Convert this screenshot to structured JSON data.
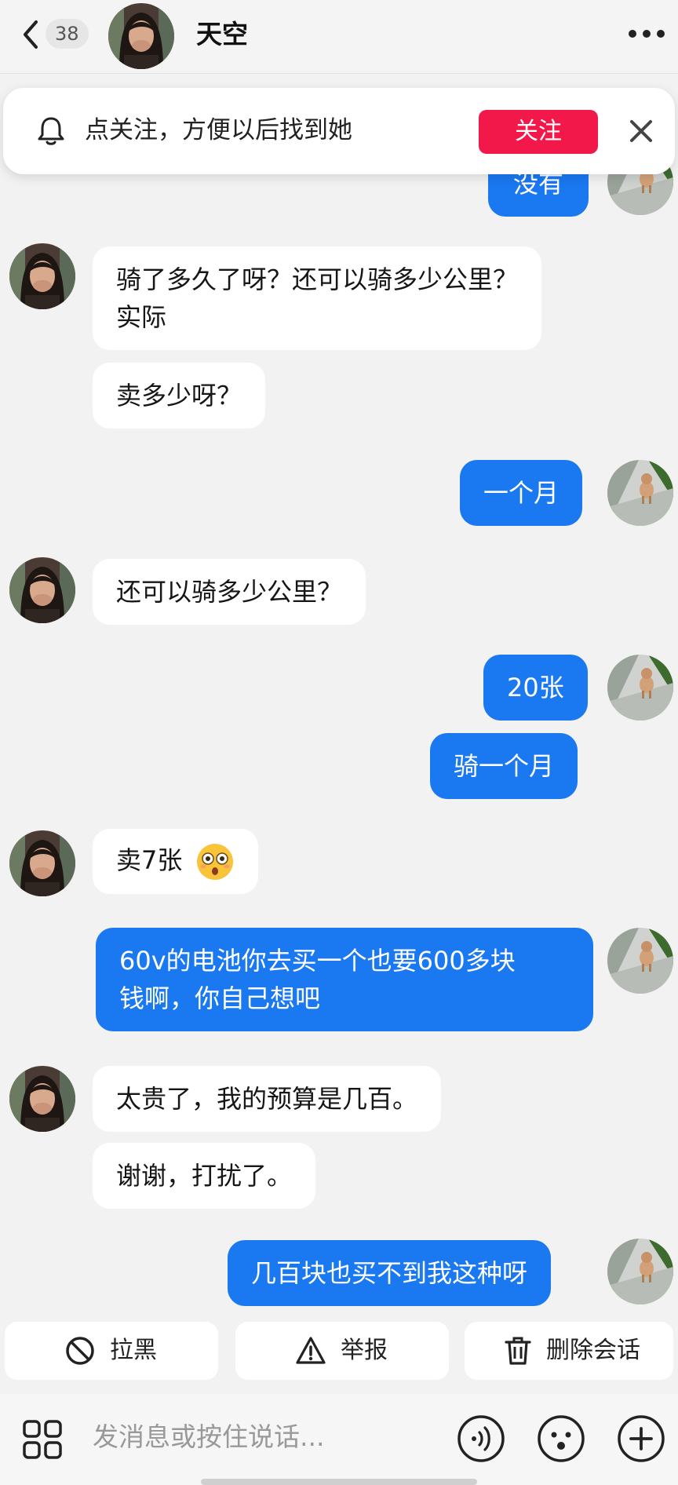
{
  "header": {
    "unread_count": "38",
    "title": "天空"
  },
  "follow_banner": {
    "text": "点关注，方便以后找到她",
    "button_label": "关注"
  },
  "messages": [
    {
      "side": "out",
      "lines": [
        "没有"
      ]
    },
    {
      "side": "in",
      "lines": [
        "骑了多久了呀？还可以骑多少公里？",
        "实际"
      ]
    },
    {
      "side": "in",
      "lines": [
        "卖多少呀？"
      ]
    },
    {
      "side": "out",
      "lines": [
        "一个月"
      ]
    },
    {
      "side": "in",
      "lines": [
        "还可以骑多少公里？"
      ]
    },
    {
      "side": "out",
      "lines": [
        "20张"
      ]
    },
    {
      "side": "out",
      "lines": [
        "骑一个月"
      ]
    },
    {
      "side": "in",
      "lines": [
        "卖7张"
      ],
      "emoji": "flushed-face-emoji"
    },
    {
      "side": "out",
      "lines": [
        "60v的电池你去买一个也要600多块",
        "钱啊，你自己想吧"
      ]
    },
    {
      "side": "in",
      "lines": [
        "太贵了，我的预算是几百。"
      ]
    },
    {
      "side": "in",
      "lines": [
        "谢谢，打扰了。"
      ]
    },
    {
      "side": "out",
      "lines": [
        "几百块也买不到我这种呀"
      ]
    }
  ],
  "actions": {
    "block_label": "拉黑",
    "report_label": "举报",
    "delete_label": "删除会话"
  },
  "input": {
    "placeholder": "发消息或按住说话..."
  },
  "icons": {
    "back": "chevron-left-icon",
    "more": "more-dots-icon",
    "bell": "bell-icon",
    "close": "close-icon",
    "block": "block-icon",
    "report": "warning-icon",
    "delete": "trash-icon",
    "apps": "apps-grid-icon",
    "voice": "voice-icon",
    "emoji": "emoji-icon",
    "add": "plus-icon"
  },
  "colors": {
    "accent_blue": "#1a78f0",
    "follow_red": "#f21849",
    "background": "#f2f2f2"
  }
}
